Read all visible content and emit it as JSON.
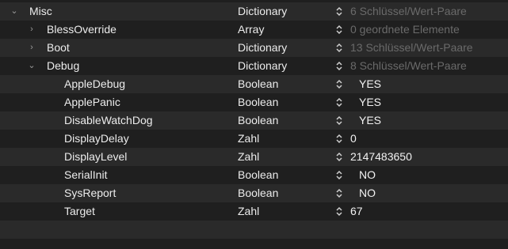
{
  "rows": [
    {
      "key": "Misc",
      "type": "Dictionary",
      "value": "6 Schlüssel/Wert-Paare",
      "dim": true,
      "expand": "open"
    },
    {
      "key": "BlessOverride",
      "type": "Array",
      "value": "0 geordnete Elemente",
      "dim": true,
      "expand": "closed"
    },
    {
      "key": "Boot",
      "type": "Dictionary",
      "value": "13 Schlüssel/Wert-Paare",
      "dim": true,
      "expand": "closed"
    },
    {
      "key": "Debug",
      "type": "Dictionary",
      "value": "8 Schlüssel/Wert-Paare",
      "dim": true,
      "expand": "open"
    },
    {
      "key": "AppleDebug",
      "type": "Boolean",
      "value": "YES"
    },
    {
      "key": "ApplePanic",
      "type": "Boolean",
      "value": "YES"
    },
    {
      "key": "DisableWatchDog",
      "type": "Boolean",
      "value": "YES"
    },
    {
      "key": "DisplayDelay",
      "type": "Zahl",
      "value": "0"
    },
    {
      "key": "DisplayLevel",
      "type": "Zahl",
      "value": "2147483650"
    },
    {
      "key": "SerialInit",
      "type": "Boolean",
      "value": "NO"
    },
    {
      "key": "SysReport",
      "type": "Boolean",
      "value": "NO"
    },
    {
      "key": "Target",
      "type": "Zahl",
      "value": "67"
    }
  ],
  "icons": {
    "expanded": "chevron-down-icon",
    "collapsed": "chevron-right-icon",
    "stepper": "up-down-stepper-icon"
  },
  "colors": {
    "background": "#1f1f1f",
    "row_alt": "#2a2a2a",
    "text": "#ececec",
    "placeholder": "#6a6a6a"
  }
}
